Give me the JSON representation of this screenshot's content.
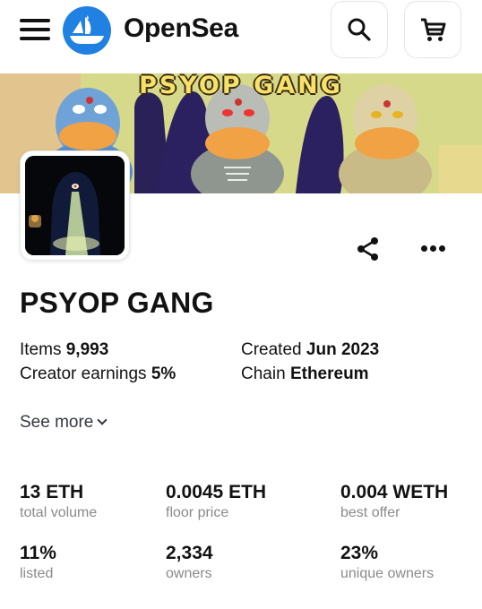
{
  "header": {
    "brand": "OpenSea",
    "icons": {
      "menu": "hamburger-icon",
      "logo": "opensea-logo",
      "search": "search-icon",
      "cart": "cart-icon"
    }
  },
  "banner": {
    "title": "PSYOP GANG"
  },
  "collection": {
    "name": "PSYOP GANG",
    "details": {
      "items_label": "Items",
      "items_value": "9,993",
      "earnings_label": "Creator earnings",
      "earnings_value": "5%",
      "created_label": "Created",
      "created_value": "Jun 2023",
      "chain_label": "Chain",
      "chain_value": "Ethereum"
    },
    "see_more": "See more"
  },
  "stats": [
    {
      "value": "13 ETH",
      "label": "total volume"
    },
    {
      "value": "0.0045 ETH",
      "label": "floor price"
    },
    {
      "value": "0.004 WETH",
      "label": "best offer"
    },
    {
      "value": "11%",
      "label": "listed"
    },
    {
      "value": "2,334",
      "label": "owners"
    },
    {
      "value": "23%",
      "label": "unique owners"
    }
  ],
  "colors": {
    "brand_blue": "#2081e2",
    "text": "#121212",
    "muted": "#8a8a8a",
    "banner_title": "#f6e26a"
  }
}
